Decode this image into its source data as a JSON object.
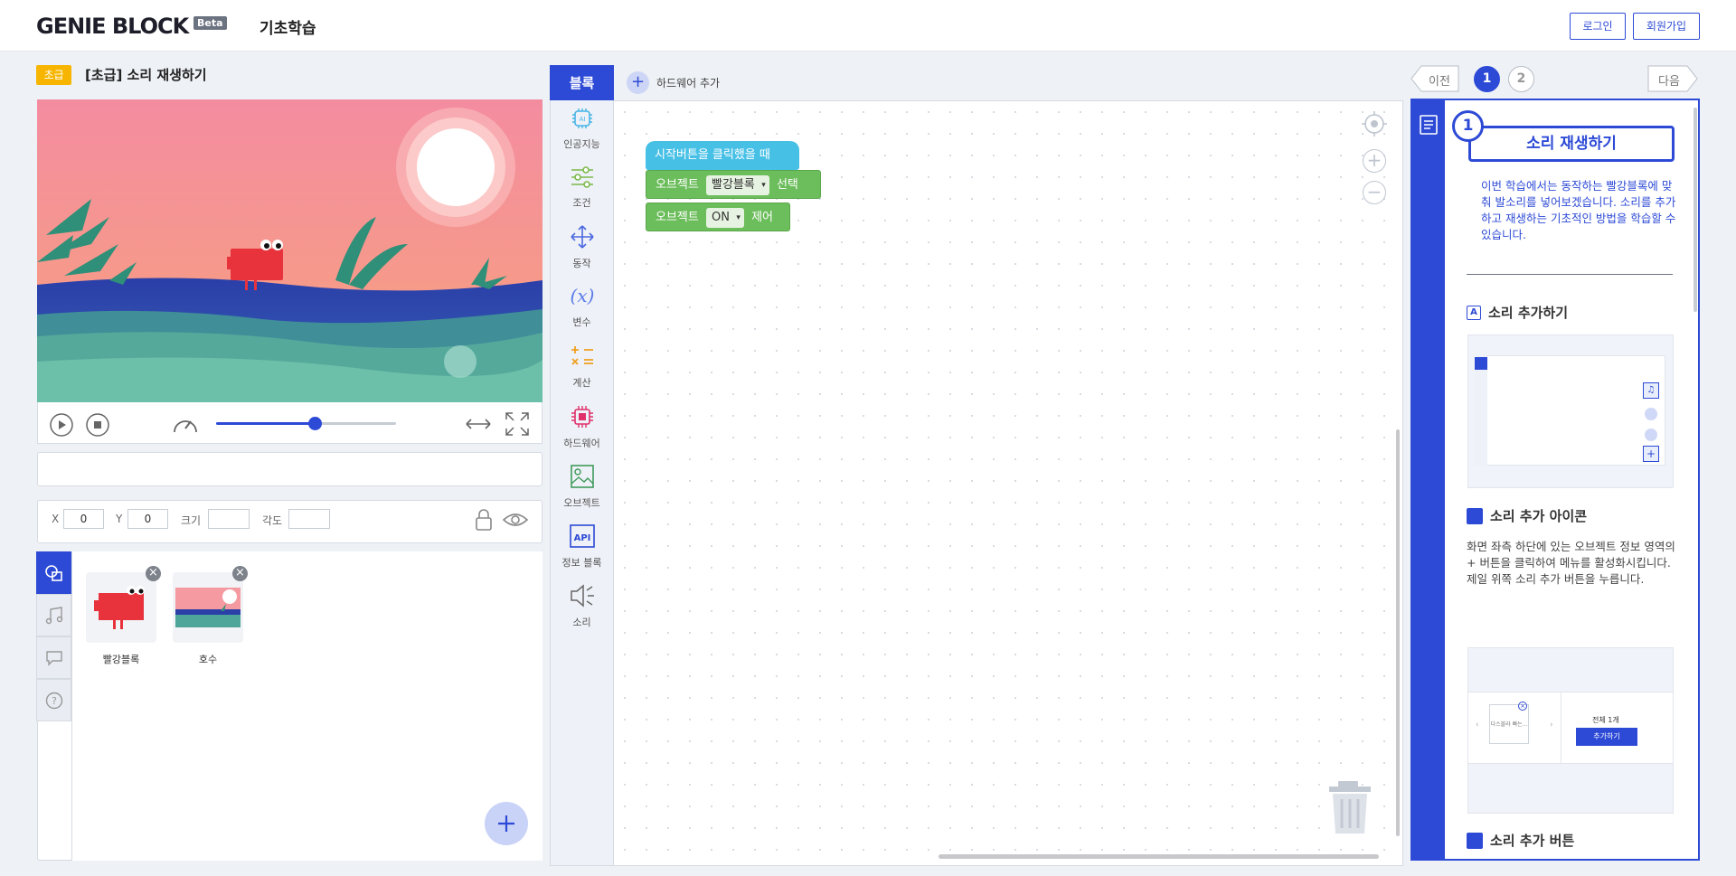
{
  "header": {
    "logo": "GENIE BLOCK",
    "beta": "Beta",
    "nav_title": "기초학습",
    "login": "로그인",
    "signup": "회원가입"
  },
  "lesson": {
    "level": "초급",
    "title": "[초급] 소리 재생하기"
  },
  "stage": {
    "speed_level": 0.55
  },
  "properties": {
    "x_label": "X",
    "x_value": "0",
    "y_label": "Y",
    "y_value": "0",
    "size_label": "크기",
    "size_value": "",
    "angle_label": "각도",
    "angle_value": ""
  },
  "objects": [
    {
      "name": "빨강블록"
    },
    {
      "name": "호수"
    }
  ],
  "palette": {
    "header": "블록",
    "add_hardware": "하드웨어 추가",
    "categories": [
      {
        "label": "인공지능",
        "icon": "ai-chip-icon"
      },
      {
        "label": "조건",
        "icon": "sliders-icon"
      },
      {
        "label": "동작",
        "icon": "move-arrows-icon"
      },
      {
        "label": "변수",
        "icon": "variable-x-icon"
      },
      {
        "label": "계산",
        "icon": "math-icon"
      },
      {
        "label": "하드웨어",
        "icon": "hardware-chip-icon"
      },
      {
        "label": "오브젝트",
        "icon": "image-icon"
      },
      {
        "label": "정보 블록",
        "icon": "api-icon"
      },
      {
        "label": "소리",
        "icon": "speaker-icon"
      }
    ]
  },
  "code_blocks": {
    "start": "시작버튼을 클릭했을 때",
    "b1_prefix": "오브젝트",
    "b1_value": "빨강블록",
    "b1_suffix": "선택",
    "b2_prefix": "오브젝트",
    "b2_value": "ON",
    "b2_suffix": "제어"
  },
  "steps": {
    "prev": "이전",
    "step1": "1",
    "step2": "2",
    "next": "다음",
    "current": "1"
  },
  "guide": {
    "number": "1",
    "title": "소리 재생하기",
    "description": "이번 학습에서는 동작하는 빨강블록에 맞춰 발소리를 넣어보겠습니다. 소리를 추가하고 재생하는 기초적인 방법을 학습할 수 있습니다.",
    "section1_title": "소리 추가하기",
    "section2_title": "소리 추가 아이콘",
    "section2_body": "화면 좌측 하단에 있는 오브젝트 정보 영역의 + 버튼을 클릭하여 메뉴를 활성화시킵니다. 제일 위쪽 소리 추가 버튼을 누릅니다.",
    "shot2_total": "전체 1개",
    "shot2_button": "추가하기",
    "shot2_file": "다스블라 빠는...",
    "section3_title": "소리 추가 버튼"
  },
  "colors": {
    "primary": "#2d4ad6",
    "level_badge": "#f7b500",
    "start_block": "#47c0e6",
    "object_block": "#6cbd5b"
  }
}
